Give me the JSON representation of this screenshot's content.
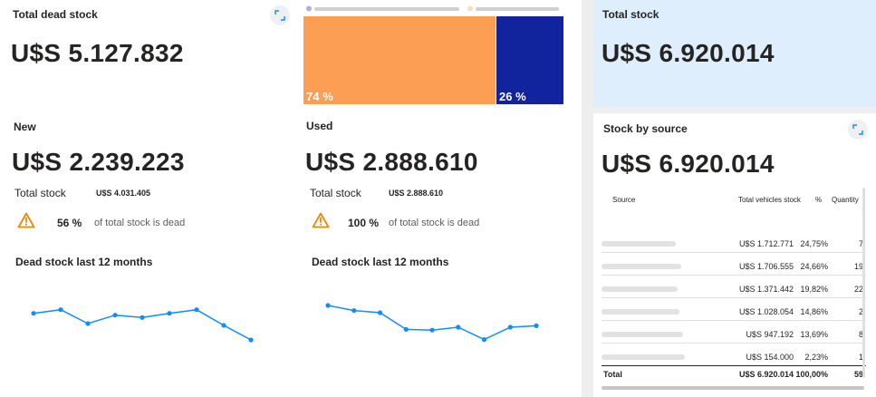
{
  "dead_stock": {
    "title": "Total dead stock",
    "value": "U$S 5.127.832"
  },
  "treemap": {
    "new_pct_label": "74 %",
    "used_pct_label": "26 %",
    "new_share": 0.74,
    "used_share": 0.26,
    "colors": {
      "new": "#fc9f54",
      "used": "#12239e"
    }
  },
  "total_stock": {
    "title": "Total stock",
    "value": "U$S 6.920.014"
  },
  "new_card": {
    "title": "New",
    "value": "U$S 2.239.223",
    "total_label": "Total stock",
    "total_value": "U$S 4.031.405",
    "dead_pct": "56 %",
    "dead_note": "of total stock is dead",
    "chart_title": "Dead stock last 12 months"
  },
  "used_card": {
    "title": "Used",
    "value": "U$S 2.888.610",
    "total_label": "Total stock",
    "total_value": "U$S 2.888.610",
    "dead_pct": "100 %",
    "dead_note": "of total stock is dead",
    "chart_title": "Dead stock last 12 months"
  },
  "source_card": {
    "title": "Stock by source",
    "value": "U$S 6.920.014",
    "headers": {
      "source": "Source",
      "total": "Total vehicles stock",
      "pct": "%",
      "qty": "Quantity"
    },
    "rows": [
      {
        "total": "U$S 1.712.771",
        "pct": "24,75%",
        "qty": "7"
      },
      {
        "total": "U$S 1.706.555",
        "pct": "24,66%",
        "qty": "19"
      },
      {
        "total": "U$S 1.371.442",
        "pct": "19,82%",
        "qty": "22"
      },
      {
        "total": "U$S 1.028.054",
        "pct": "14,86%",
        "qty": "2"
      },
      {
        "total": "U$S 947.192",
        "pct": "13,69%",
        "qty": "8"
      },
      {
        "total": "U$S 154.000",
        "pct": "2,23%",
        "qty": "1"
      }
    ],
    "total_row": {
      "label": "Total",
      "total": "U$S 6.920.014",
      "pct": "100,00%",
      "qty": "59"
    }
  },
  "colors": {
    "accent": "#118dff",
    "warning": "#e8890c",
    "highlight_panel": "#deeefc"
  },
  "chart_data": [
    {
      "type": "line",
      "x": [
        1,
        2,
        3,
        4,
        5,
        6,
        7,
        8,
        9
      ],
      "series": [
        {
          "values": [
            2.22,
            2.28,
            2.05,
            2.19,
            2.15,
            2.22,
            2.28,
            2.02,
            1.78
          ]
        }
      ],
      "ylim": [
        1.6,
        2.5
      ],
      "grid": false,
      "legend": "none"
    },
    {
      "type": "line",
      "x": [
        1,
        2,
        3,
        4,
        5,
        6,
        7,
        8,
        9
      ],
      "series": [
        {
          "values": [
            3.05,
            2.98,
            2.95,
            2.72,
            2.71,
            2.75,
            2.58,
            2.75,
            2.77
          ]
        }
      ],
      "ylim": [
        2.45,
        3.2
      ],
      "grid": false,
      "legend": "none"
    }
  ]
}
